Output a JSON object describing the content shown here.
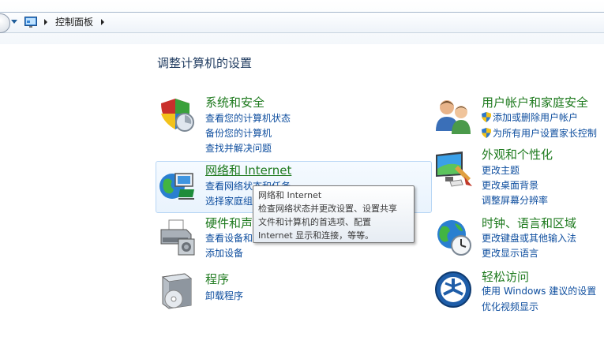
{
  "address_bar": {
    "breadcrumb": "控制面板"
  },
  "main": {
    "title": "调整计算机的设置"
  },
  "categories": {
    "system": {
      "title": "系统和安全",
      "links": [
        "查看您的计算机状态",
        "备份您的计算机",
        "查找并解决问题"
      ]
    },
    "network": {
      "title": "网络和 Internet",
      "links": [
        "查看网络状态和任务",
        "选择家庭组和共享选项"
      ]
    },
    "hardware": {
      "title": "硬件和声音",
      "links": [
        "查看设备和打印机",
        "添加设备"
      ]
    },
    "programs": {
      "title": "程序",
      "links": [
        "卸载程序"
      ]
    },
    "users": {
      "title": "用户帐户和家庭安全",
      "links": [
        "添加或删除用户帐户",
        "为所有用户设置家长控制"
      ]
    },
    "appearance": {
      "title": "外观和个性化",
      "links": [
        "更改主题",
        "更改桌面背景",
        "调整屏幕分辨率"
      ]
    },
    "clock": {
      "title": "时钟、语言和区域",
      "links": [
        "更改键盘或其他输入法",
        "更改显示语言"
      ]
    },
    "access": {
      "title": "轻松访问",
      "links": [
        "使用 Windows 建议的设置",
        "优化视频显示"
      ]
    }
  },
  "tooltip": {
    "title": "网络和 Internet",
    "lines": [
      "检查网络状态并更改设置、设置共享",
      "文件和计算机的首选项、配置",
      "Internet 显示和连接，等等。"
    ]
  },
  "colors": {
    "category_title": "#1e7a1e",
    "link": "#0d4d9e",
    "page_title": "#1e3a5f"
  },
  "icons": {
    "system": "shield-security-icon",
    "network": "globe-network-icon",
    "hardware": "printer-icon",
    "programs": "program-box-icon",
    "users": "users-icon",
    "appearance": "monitor-paint-icon",
    "clock": "globe-clock-icon",
    "access": "ease-of-access-icon"
  }
}
